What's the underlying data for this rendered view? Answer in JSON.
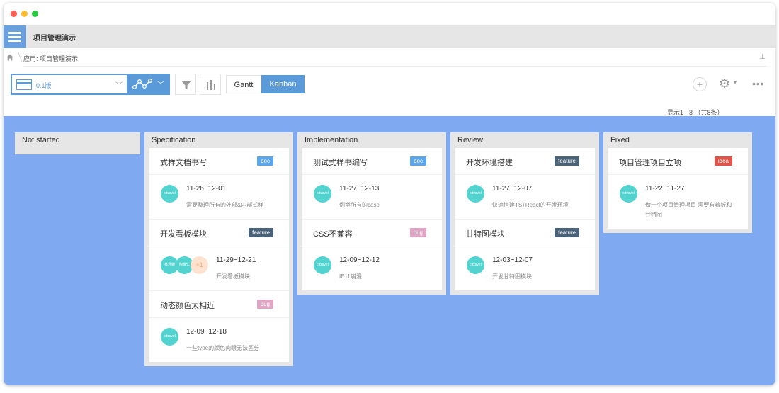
{
  "app": {
    "title": "项目管理演示"
  },
  "breadcrumb": {
    "text": "应用: 项目管理演示"
  },
  "toolbar": {
    "version_value": "0.1版",
    "view_gantt": "Gantt",
    "view_kanban": "Kanban",
    "active_view": "Kanban"
  },
  "summary": {
    "count_text": "显示1 - 8 （共8条）"
  },
  "colors": {
    "accent": "#5b9ad8",
    "board_bg": "#7faaf2",
    "avatar": "#52d3cf",
    "tag_doc": "#5ba5e8",
    "tag_feature": "#4a6378",
    "tag_bug": "#e0a5c4",
    "tag_idea": "#e0554a"
  },
  "columns": [
    {
      "title": "Not started",
      "cards": []
    },
    {
      "title": "Specification",
      "cards": [
        {
          "title": "式样文档书写",
          "tag": "doc",
          "date": "11-26~12-01",
          "desc": "需要整理所有的外部&内部式样",
          "avatars": [
            "cdxsvel"
          ]
        },
        {
          "title": "开发看板模块",
          "tag": "feature",
          "date": "11-29~12-21",
          "desc": "开发看板模块",
          "avatars": [
            "林月娥",
            "陶世仁",
            "+1"
          ]
        },
        {
          "title": "动态颜色太相近",
          "tag": "bug",
          "date": "12-09~12-18",
          "desc": "一些type的颜色肉眼无法区分",
          "avatars": [
            "cdxsvel"
          ]
        }
      ]
    },
    {
      "title": "Implementation",
      "cards": [
        {
          "title": "测试式样书编写",
          "tag": "doc",
          "date": "11-27~12-13",
          "desc": "例举所有的case",
          "avatars": [
            "cdxsvel"
          ]
        },
        {
          "title": "CSS不兼容",
          "tag": "bug",
          "date": "12-09~12-12",
          "desc": "IE11崩溃",
          "avatars": [
            "cdxsvel"
          ]
        }
      ]
    },
    {
      "title": "Review",
      "cards": [
        {
          "title": "开发环境搭建",
          "tag": "feature",
          "date": "11-27~12-07",
          "desc": "快速搭建TS+React的开发环境",
          "avatars": [
            "cdxsvel"
          ]
        },
        {
          "title": "甘特图模块",
          "tag": "feature",
          "date": "12-03~12-07",
          "desc": "开发甘特图模块",
          "avatars": [
            "cdxsvel"
          ]
        }
      ]
    },
    {
      "title": "Fixed",
      "cards": [
        {
          "title": "项目管理项目立项",
          "tag": "idea",
          "date": "11-22~11-27",
          "desc": "做一个项目管理项目 需要有着板和甘特图",
          "avatars": [
            "cdxsvel"
          ]
        }
      ]
    }
  ]
}
